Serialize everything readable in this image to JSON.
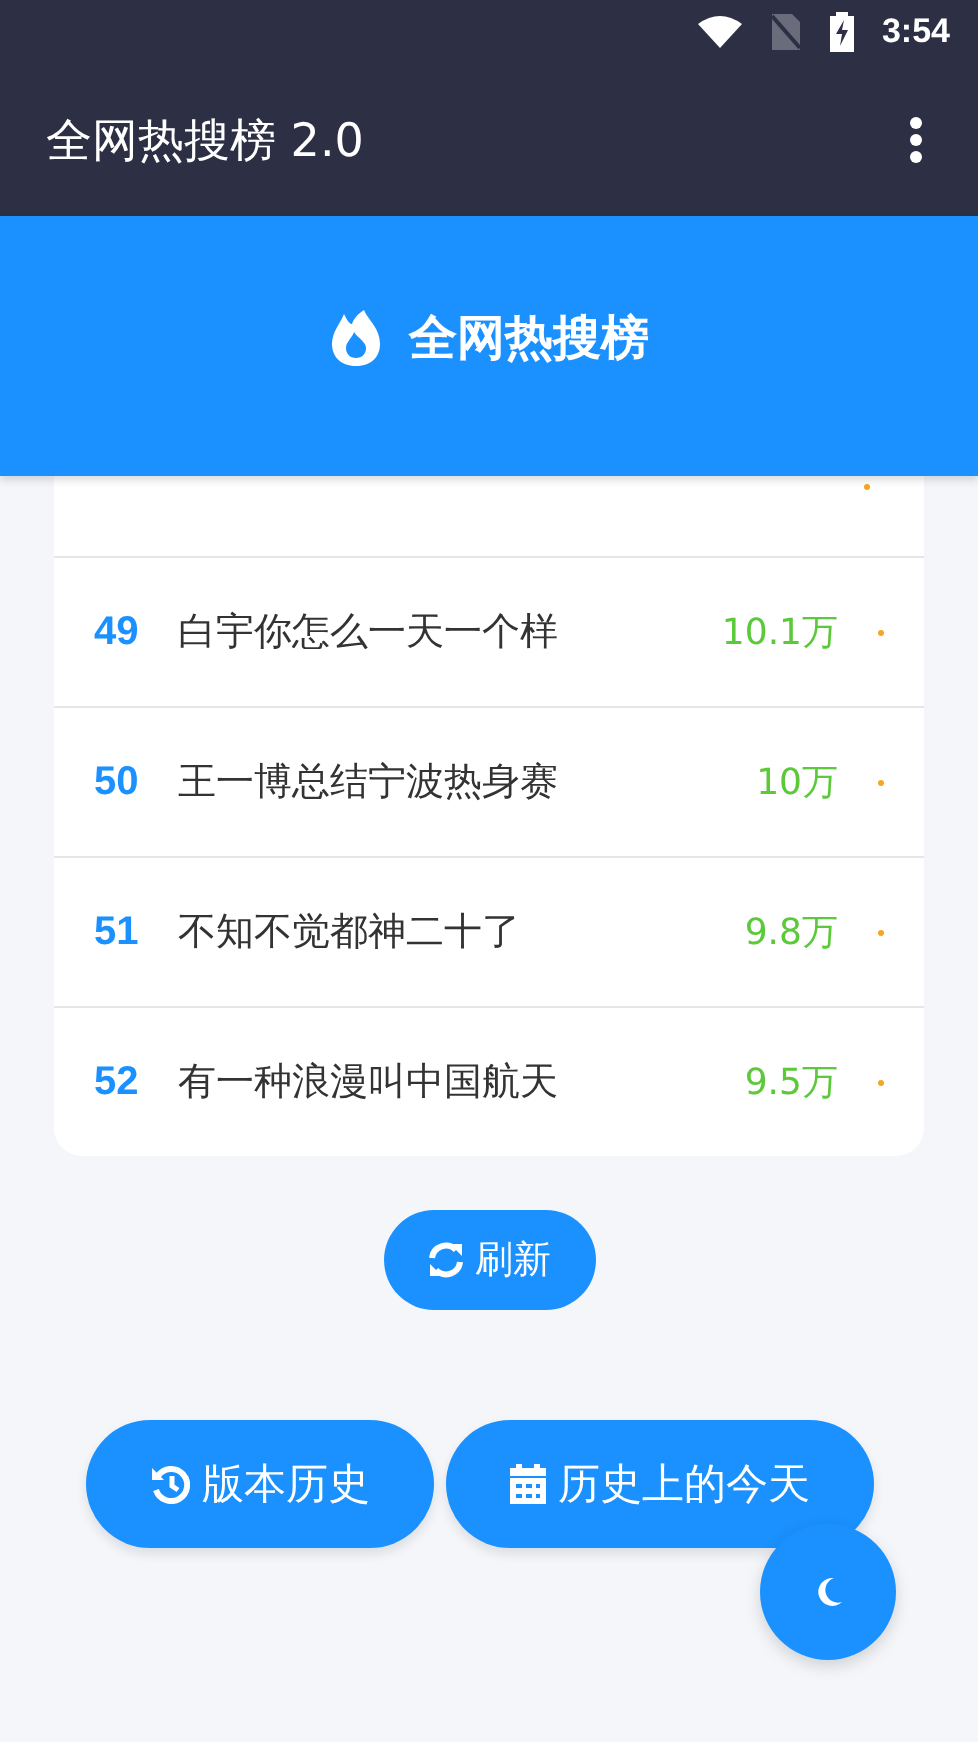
{
  "status_bar": {
    "time": "3:54"
  },
  "app_bar": {
    "title": "全网热搜榜 2.0"
  },
  "header": {
    "title": "全网热搜榜"
  },
  "list": [
    {
      "rank": "49",
      "title": "白宇你怎么一天一个样",
      "heat": "10.1万"
    },
    {
      "rank": "50",
      "title": "王一博总结宁波热身赛",
      "heat": "10万"
    },
    {
      "rank": "51",
      "title": "不知不觉都神二十了",
      "heat": "9.8万"
    },
    {
      "rank": "52",
      "title": "有一种浪漫叫中国航天",
      "heat": "9.5万"
    }
  ],
  "refresh_button": {
    "label": "刷新"
  },
  "buttons": [
    {
      "kind": "history",
      "label": "版本历史"
    },
    {
      "kind": "calendar",
      "label": "历史上的今天"
    }
  ]
}
